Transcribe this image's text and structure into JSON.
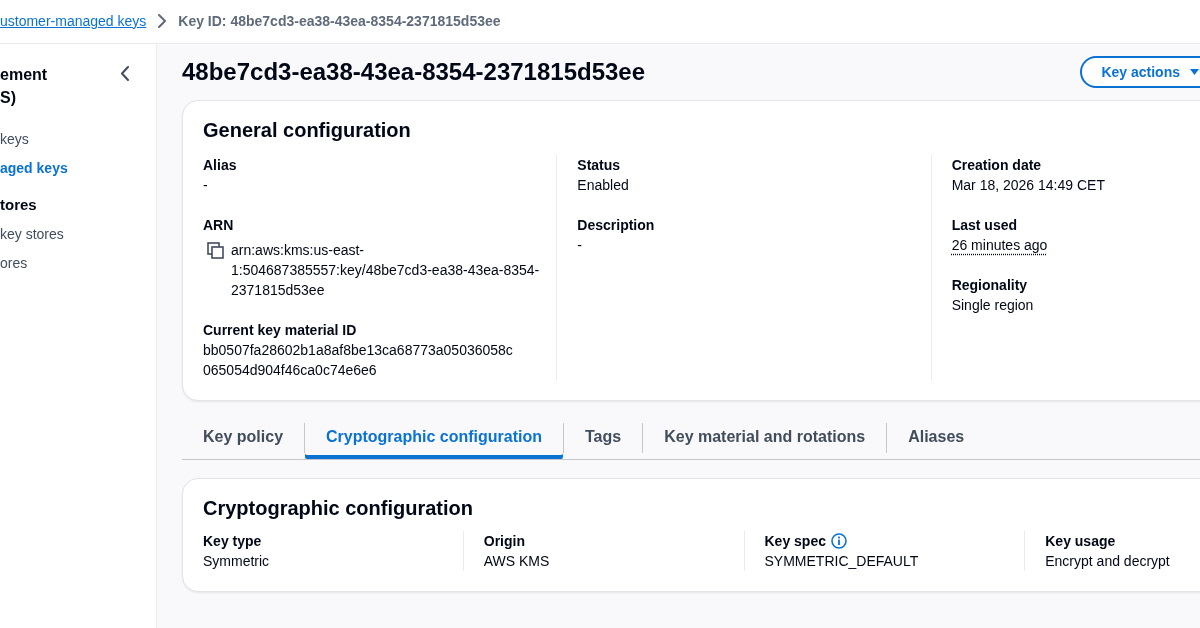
{
  "breadcrumbs": [
    {
      "kind": "link",
      "label": "ustomer-managed keys"
    },
    {
      "kind": "current",
      "label": "Key ID: 48be7cd3-ea38-43ea-8354-2371815d53ee"
    }
  ],
  "sidebar": {
    "title": "ement\nS)",
    "links": [
      {
        "label": "keys",
        "selected": false
      },
      {
        "label": "aged keys",
        "selected": true
      }
    ],
    "sections": [
      {
        "heading": "tores",
        "links": [
          {
            "label": "key stores",
            "selected": false
          },
          {
            "label": "ores",
            "selected": false
          }
        ]
      }
    ]
  },
  "page_header": {
    "title": "48be7cd3-ea38-43ea-8354-2371815d53ee",
    "actions_button": "Key actions"
  },
  "general_configuration": {
    "title": "General configuration",
    "columns": [
      [
        {
          "kind": "text",
          "label": "Alias",
          "value": "-"
        },
        {
          "kind": "copyable",
          "label": "ARN",
          "value": "arn:aws:kms:us-east-1:504687385557:key/48be7cd3-ea38-43ea-8354-2371815d53ee"
        },
        {
          "kind": "text",
          "label": "Current key material ID",
          "value": "bb0507fa28602b1a8af8be13ca68773a05036058c065054d904f46ca0c74e6e6"
        }
      ],
      [
        {
          "kind": "text",
          "label": "Status",
          "value": "Enabled"
        },
        {
          "kind": "text",
          "label": "Description",
          "value": "-"
        }
      ],
      [
        {
          "kind": "text",
          "label": "Creation date",
          "value": "Mar 18, 2026 14:49 CET"
        },
        {
          "kind": "popover",
          "label": "Last used",
          "value": "26 minutes ago"
        },
        {
          "kind": "text",
          "label": "Regionality",
          "value": "Single region"
        }
      ]
    ]
  },
  "tabs": [
    {
      "label": "Key policy",
      "selected": false
    },
    {
      "label": "Cryptographic configuration",
      "selected": true
    },
    {
      "label": "Tags",
      "selected": false
    },
    {
      "label": "Key material and rotations",
      "selected": false
    },
    {
      "label": "Aliases",
      "selected": false
    }
  ],
  "cryptographic_configuration": {
    "title": "Cryptographic configuration",
    "fields": [
      {
        "kind": "text",
        "label": "Key type",
        "value": "Symmetric"
      },
      {
        "kind": "text",
        "label": "Origin",
        "value": "AWS KMS"
      },
      {
        "kind": "info",
        "label": "Key spec",
        "value": "SYMMETRIC_DEFAULT"
      },
      {
        "kind": "text",
        "label": "Key usage",
        "value": "Encrypt and decrypt"
      }
    ]
  }
}
